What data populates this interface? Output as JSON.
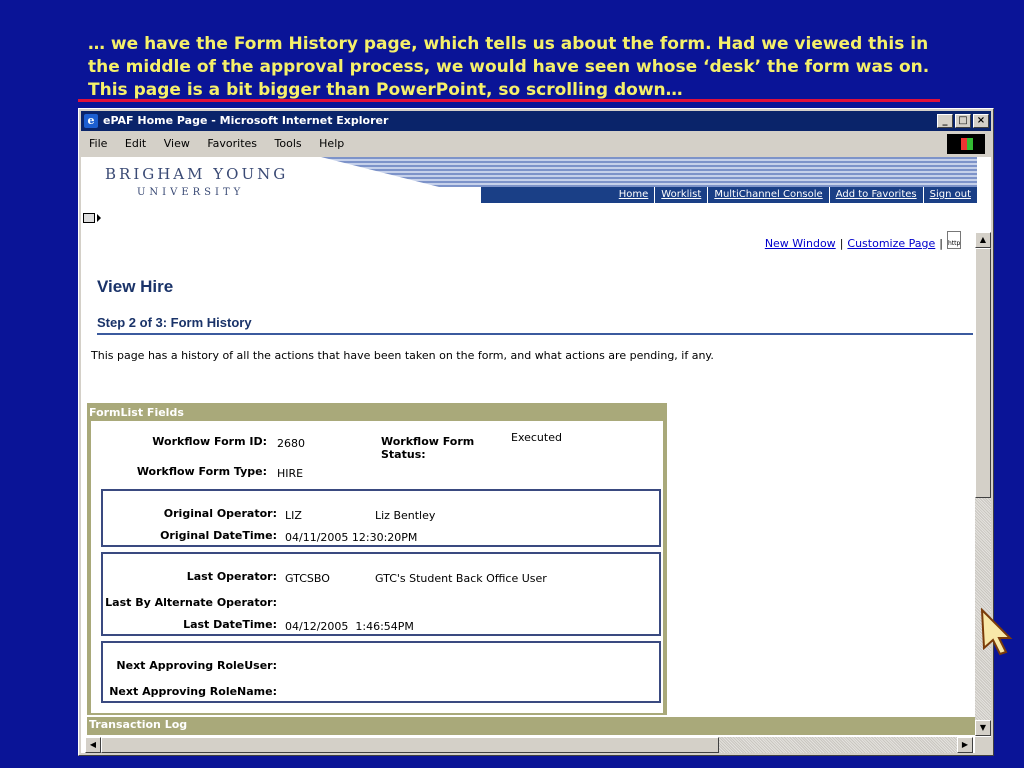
{
  "caption": "… we have the Form History page, which tells us about the form. Had we viewed this in the middle of the approval process, we would have seen whose ‘desk’ the form was on. This page is a bit bigger than PowerPoint, so scrolling down…",
  "window": {
    "title": "ePAF Home Page - Microsoft Internet Explorer",
    "minimize": "_",
    "maximize": "□",
    "close": "×"
  },
  "menus": [
    "File",
    "Edit",
    "View",
    "Favorites",
    "Tools",
    "Help"
  ],
  "banner": {
    "line1": "BRIGHAM YOUNG",
    "line2": "UNIVERSITY"
  },
  "nav": [
    "Home",
    "Worklist",
    "MultiChannel Console",
    "Add to Favorites",
    "Sign out"
  ],
  "toplinks": {
    "new_window": "New Window",
    "customize": "Customize Page",
    "http_icon": "http"
  },
  "page": {
    "title": "View Hire",
    "step": "Step 2 of 3: Form History",
    "description": "This page has a history of all the actions that have been taken on the form, and what actions are pending, if any."
  },
  "formlist": {
    "header": "FormList Fields",
    "workflow_form_id_label": "Workflow Form ID:",
    "workflow_form_id": "2680",
    "workflow_form_status_label_1": "Workflow Form",
    "workflow_form_status_label_2": "Status:",
    "workflow_form_status": "Executed",
    "workflow_form_type_label": "Workflow Form Type:",
    "workflow_form_type": "HIRE",
    "original_operator_label": "Original Operator:",
    "original_operator_id": "LIZ",
    "original_operator_name": "Liz Bentley",
    "original_datetime_label": "Original DateTime:",
    "original_datetime": "04/11/2005 12:30:20PM",
    "last_operator_label": "Last Operator:",
    "last_operator_id": "GTCSBO",
    "last_operator_name": "GTC's Student Back Office User",
    "last_alt_operator_label": "Last By Alternate Operator:",
    "last_datetime_label": "Last DateTime:",
    "last_datetime": "04/12/2005  1:46:54PM",
    "next_role_user_label": "Next Approving RoleUser:",
    "next_role_name_label": "Next Approving RoleName:"
  },
  "transaction_log": "Transaction Log"
}
